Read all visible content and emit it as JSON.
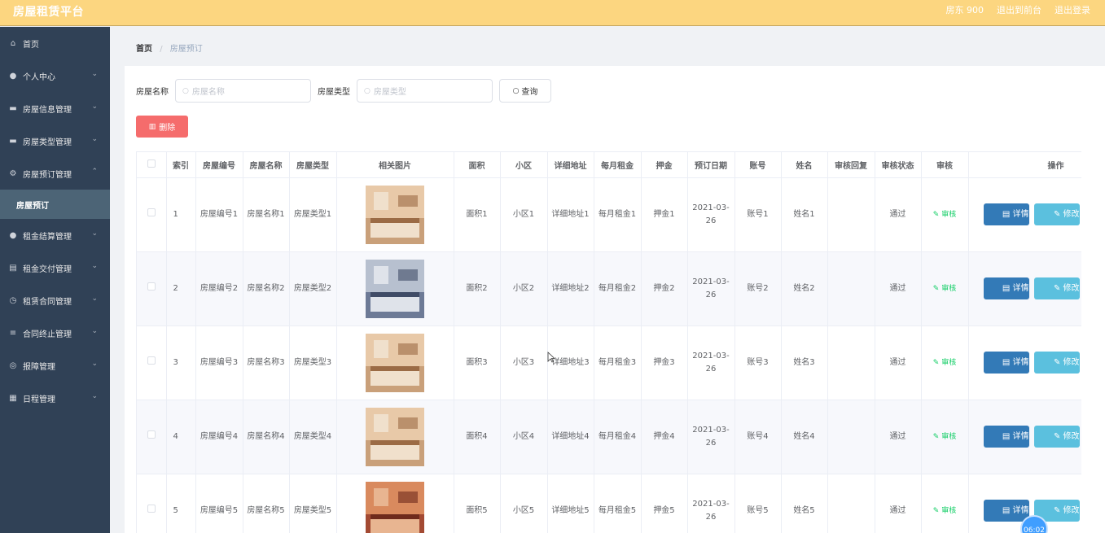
{
  "app": {
    "title": "房屋租赁平台"
  },
  "topbar": {
    "user_label": "房东 900",
    "back_label": "退出到前台",
    "logout_label": "退出登录"
  },
  "sidebar": {
    "items": [
      {
        "label": "首页",
        "icon": "home-icon"
      },
      {
        "label": "个人中心",
        "icon": "user-icon"
      },
      {
        "label": "房屋信息管理",
        "icon": "monitor-icon"
      },
      {
        "label": "房屋类型管理",
        "icon": "monitor-icon"
      },
      {
        "label": "房屋预订管理",
        "icon": "gear-icon"
      },
      {
        "label": "租金结算管理",
        "icon": "user-icon"
      },
      {
        "label": "租金交付管理",
        "icon": "document-icon"
      },
      {
        "label": "租赁合同管理",
        "icon": "clock-icon"
      },
      {
        "label": "合同终止管理",
        "icon": "sliders-icon"
      },
      {
        "label": "报障管理",
        "icon": "globe-icon"
      },
      {
        "label": "日程管理",
        "icon": "calendar-icon"
      }
    ],
    "active_sub": "房屋预订"
  },
  "breadcrumb": {
    "home": "首页",
    "current": "房屋预订"
  },
  "search": {
    "name_label": "房屋名称",
    "name_placeholder": "房屋名称",
    "type_label": "房屋类型",
    "type_placeholder": "房屋类型",
    "query_label": "查询"
  },
  "delete_label": "删除",
  "table": {
    "headers": [
      "索引",
      "房屋编号",
      "房屋名称",
      "房屋类型",
      "相关图片",
      "面积",
      "小区",
      "详细地址",
      "每月租金",
      "押金",
      "预订日期",
      "账号",
      "姓名",
      "审核回复",
      "审核状态",
      "审核",
      "操作"
    ],
    "rows": [
      {
        "index": "1",
        "code": "房屋编号1",
        "name": "房屋名称1",
        "type": "房屋类型1",
        "area": "面积1",
        "community": "小区1",
        "address": "详细地址1",
        "rent": "每月租金1",
        "deposit": "押金1",
        "date": "2021-03-26",
        "account": "账号1",
        "person": "姓名1",
        "reply": "",
        "status": "通过"
      },
      {
        "index": "2",
        "code": "房屋编号2",
        "name": "房屋名称2",
        "type": "房屋类型2",
        "area": "面积2",
        "community": "小区2",
        "address": "详细地址2",
        "rent": "每月租金2",
        "deposit": "押金2",
        "date": "2021-03-26",
        "account": "账号2",
        "person": "姓名2",
        "reply": "",
        "status": "通过"
      },
      {
        "index": "3",
        "code": "房屋编号3",
        "name": "房屋名称3",
        "type": "房屋类型3",
        "area": "面积3",
        "community": "小区3",
        "address": "详细地址3",
        "rent": "每月租金3",
        "deposit": "押金3",
        "date": "2021-03-26",
        "account": "账号3",
        "person": "姓名3",
        "reply": "",
        "status": "通过"
      },
      {
        "index": "4",
        "code": "房屋编号4",
        "name": "房屋名称4",
        "type": "房屋类型4",
        "area": "面积4",
        "community": "小区4",
        "address": "详细地址4",
        "rent": "每月租金4",
        "deposit": "押金4",
        "date": "2021-03-26",
        "account": "账号4",
        "person": "姓名4",
        "reply": "",
        "status": "通过"
      },
      {
        "index": "5",
        "code": "房屋编号5",
        "name": "房屋名称5",
        "type": "房屋类型5",
        "area": "面积5",
        "community": "小区5",
        "address": "详细地址5",
        "rent": "每月租金5",
        "deposit": "押金5",
        "date": "2021-03-26",
        "account": "账号5",
        "person": "姓名5",
        "reply": "",
        "status": "通过"
      }
    ],
    "audit_label": "审核",
    "detail_label": "详情",
    "edit_label": "修改"
  },
  "timer": "06:02",
  "colors": {
    "topbar": "#fcd680",
    "sidebar": "#304156",
    "delete": "#f56c6c",
    "detail": "#337ab7",
    "edit": "#5bc0de",
    "audit": "#13ce66"
  }
}
